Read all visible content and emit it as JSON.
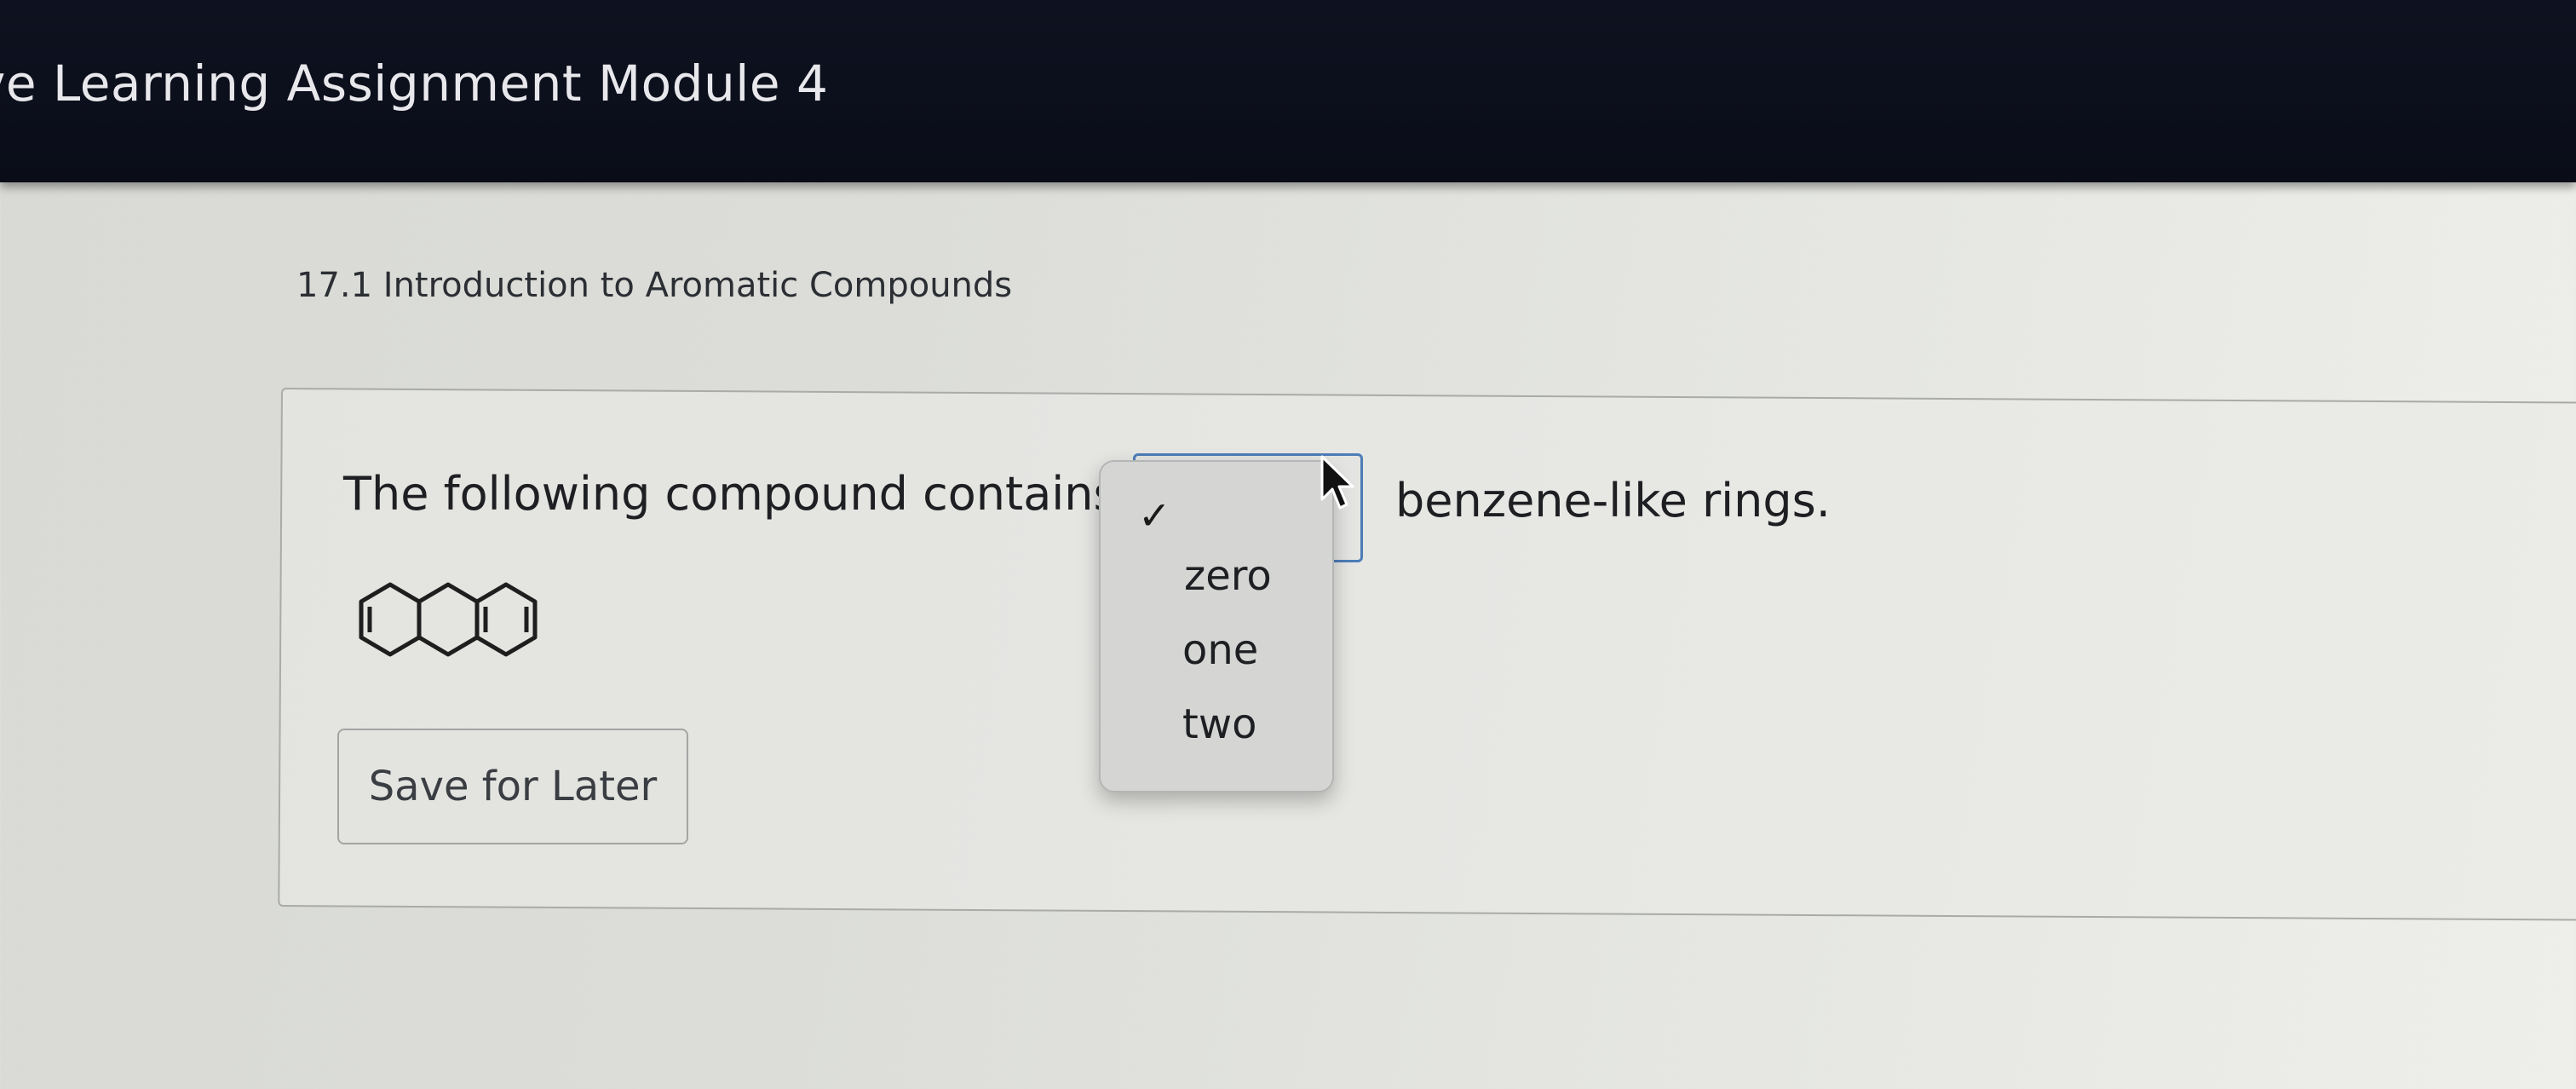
{
  "header": {
    "title": "ve Learning Assignment Module 4"
  },
  "section": {
    "title": "17.1 Introduction to Aromatic Compounds"
  },
  "question": {
    "prompt_before": "The following compound contains",
    "prompt_after": "benzene-like rings.",
    "dropdown": {
      "selected_value": "",
      "check_mark": "✓",
      "options": [
        "zero",
        "one",
        "two"
      ]
    }
  },
  "actions": {
    "save_label": "Save for Later"
  },
  "colors": {
    "header_bg": "#0b0e19",
    "select_focus_border": "#4d7db8",
    "menu_bg": "#d5d6d4"
  },
  "icons": {
    "cursor": "mouse-pointer-icon",
    "check": "checkmark-icon",
    "molecule": "fused-tricyclic-molecule"
  }
}
